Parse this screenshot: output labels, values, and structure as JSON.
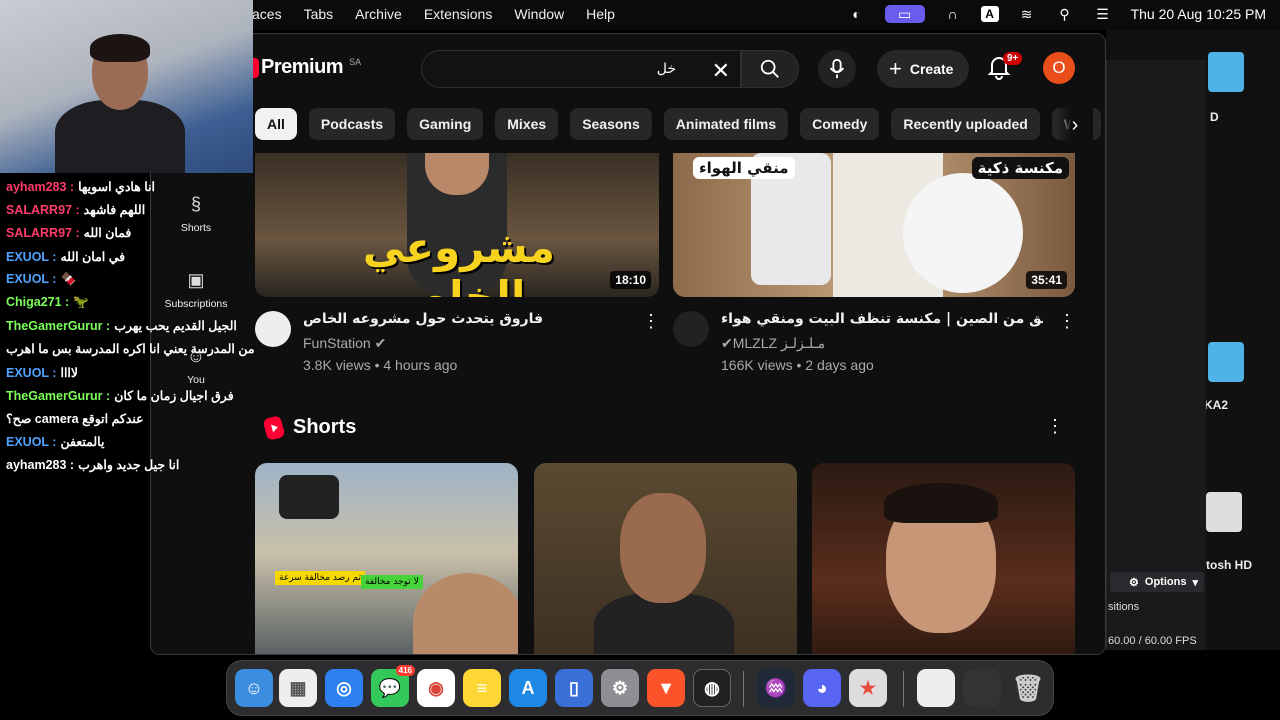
{
  "menubar": {
    "menus": [
      "aces",
      "Tabs",
      "Archive",
      "Extensions",
      "Window",
      "Help"
    ],
    "ai_badge": "A",
    "datetime": "Thu 20 Aug  10:25 PM"
  },
  "chat": [
    {
      "user": "ayham283",
      "color": "#ff3b6b",
      "msg": "انا هادي اسويها"
    },
    {
      "user": "SALARR97",
      "color": "#ff3b6b",
      "msg": "اللهم فاشهد"
    },
    {
      "user": "SALARR97",
      "color": "#ff3b6b",
      "msg": "فمان الله"
    },
    {
      "user": "EXUOL",
      "color": "#4fa3ff",
      "msg": "في امان الله"
    },
    {
      "user": "EXUOL",
      "color": "#4fa3ff",
      "msg": "🍫"
    },
    {
      "user": "Chiga271",
      "color": "#7dff5a",
      "msg": "🦖"
    },
    {
      "user": "TheGamerGurur",
      "color": "#7dff5a",
      "msg": "الجيل القديم يحب يهرب"
    },
    {
      "user": "",
      "color": "#fff",
      "msg": "من المدرسة يعني انا اكره المدرسة بس ما اهرب"
    },
    {
      "user": "EXUOL",
      "color": "#4fa3ff",
      "msg": "لاااا"
    },
    {
      "user": "TheGamerGurur",
      "color": "#7dff5a",
      "msg": "فرق اجيال زمان ما كان"
    },
    {
      "user": "",
      "color": "#fff",
      "msg": "صح؟ camera عندكم اتوقع"
    },
    {
      "user": "EXUOL",
      "color": "#4fa3ff",
      "msg": "يالمتعفن"
    },
    {
      "user": "ayham283",
      "color": "#fff",
      "msg": "انا جيل جديد واهرب"
    }
  ],
  "sidebar": {
    "shorts": "Shorts",
    "subscriptions": "Subscriptions",
    "you": "You"
  },
  "header": {
    "logo_text": "Premium",
    "region": "SA",
    "search_value": "خل",
    "create_label": "Create",
    "notif_count": "9+",
    "avatar_letter": "O"
  },
  "chips": [
    "All",
    "Podcasts",
    "Gaming",
    "Mixes",
    "Seasons",
    "Animated films",
    "Comedy",
    "Recently uploaded",
    "Wat"
  ],
  "videos": [
    {
      "thumb_text": "مشروعي الخاص",
      "duration": "18:10",
      "title": "فاروق يتحدث حول مشروعه الخاص",
      "channel": "FunStation",
      "meta": "3.8K views • 4 hours ago"
    },
    {
      "thumb_text_left": "منقي الهواء",
      "thumb_text_right": "مكنسة ذكية",
      "duration": "35:41",
      "title": "فتح صناديق من الصين | مكنسة تنظف البيت ومنقي هواء 🚨🚨",
      "channel": "MLZLZ مـلـزلـز",
      "meta": "166K views • 2 days ago"
    }
  ],
  "shorts": {
    "heading": "Shorts",
    "tag1": "تم رصد مخالفة سرعة",
    "tag2": "لا توجد مخالفة"
  },
  "desktop": {
    "label1": "D",
    "label2": "KA2",
    "label3": "tosh HD"
  },
  "obs": {
    "options": "Options",
    "transitions": "sitions",
    "fps": "60.00 / 60.00 FPS"
  },
  "dock": {
    "messages_badge": "416"
  }
}
